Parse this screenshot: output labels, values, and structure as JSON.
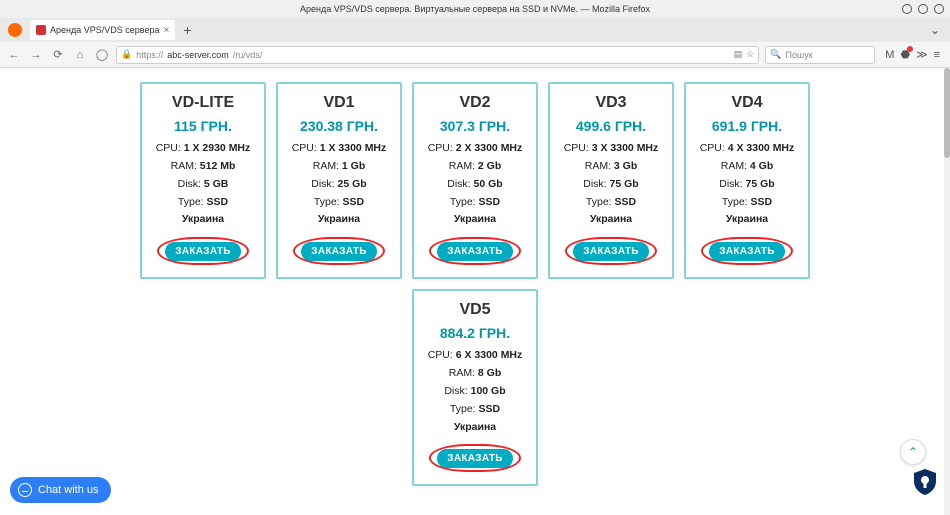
{
  "window": {
    "title": "Аренда VPS/VDS сервера. Виртуальные сервера на SSD и NVMe. — Mozilla Firefox"
  },
  "tab": {
    "label": "Аренда VPS/VDS сервера"
  },
  "nav": {
    "url_prefix": "https://",
    "url_host": "abc-server.com",
    "url_path": "/ru/vds/",
    "search_placeholder": "Пошук"
  },
  "labels": {
    "cpu": "CPU:",
    "ram": "RAM:",
    "disk": "Disk:",
    "type": "Type:",
    "order": "ЗАКАЗАТЬ"
  },
  "plans": [
    {
      "name": "VD-LITE",
      "price": "115 ГРН.",
      "cpu": "1 X 2930 MHz",
      "ram": "512 Mb",
      "disk": "5 GB",
      "type": "SSD",
      "location": "Украина"
    },
    {
      "name": "VD1",
      "price": "230.38 ГРН.",
      "cpu": "1 X 3300 MHz",
      "ram": "1 Gb",
      "disk": "25 Gb",
      "type": "SSD",
      "location": "Украина"
    },
    {
      "name": "VD2",
      "price": "307.3 ГРН.",
      "cpu": "2 X 3300 MHz",
      "ram": "2 Gb",
      "disk": "50 Gb",
      "type": "SSD",
      "location": "Украина"
    },
    {
      "name": "VD3",
      "price": "499.6 ГРН.",
      "cpu": "3 X 3300 MHz",
      "ram": "3 Gb",
      "disk": "75 Gb",
      "type": "SSD",
      "location": "Украина"
    },
    {
      "name": "VD4",
      "price": "691.9 ГРН.",
      "cpu": "4 X 3300 MHz",
      "ram": "4 Gb",
      "disk": "75 Gb",
      "type": "SSD",
      "location": "Украина"
    },
    {
      "name": "VD5",
      "price": "884.2 ГРН.",
      "cpu": "6 X 3300 MHz",
      "ram": "8 Gb",
      "disk": "100 Gb",
      "type": "SSD",
      "location": "Украина"
    }
  ],
  "chat": {
    "label": "Chat with us"
  }
}
